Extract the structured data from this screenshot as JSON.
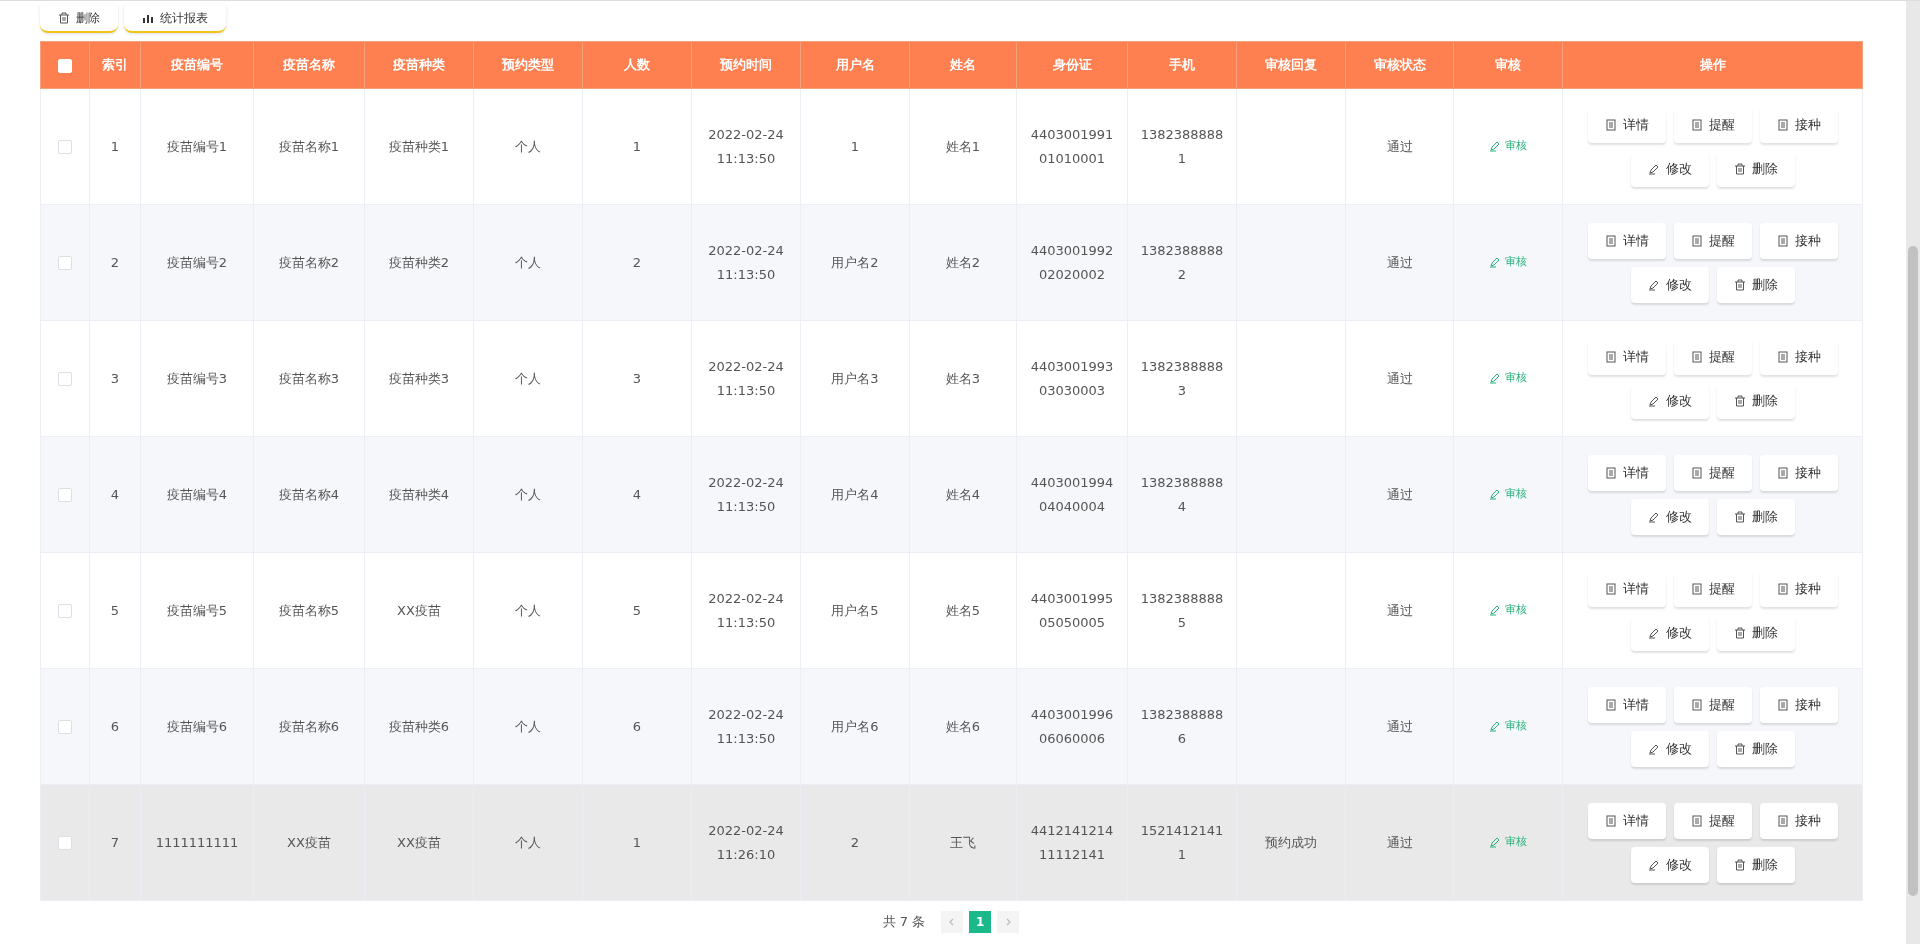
{
  "toolbar": [
    {
      "label": "删除",
      "kind": "trash"
    },
    {
      "label": "统计报表",
      "kind": "chart"
    }
  ],
  "table": {
    "select_all_checked": false,
    "columns": [
      "索引",
      "疫苗编号",
      "疫苗名称",
      "疫苗种类",
      "预约类型",
      "人数",
      "预约时间",
      "用户名",
      "姓名",
      "身份证",
      "手机",
      "审核回复",
      "审核状态",
      "审核",
      "操作"
    ],
    "rows": [
      {
        "checked": false,
        "hovered": false,
        "cells": [
          "1",
          "疫苗编号1",
          "疫苗名称1",
          "疫苗种类1",
          "个人",
          "1",
          "2022-02-24 11:13:50",
          "1",
          "姓名1",
          "440300199101010001",
          "13823888881",
          "",
          "通过"
        ],
        "audit": "审核",
        "actions": [
          {
            "label": "详情",
            "kind": "doc"
          },
          {
            "label": "提醒",
            "kind": "doc"
          },
          {
            "label": "接种",
            "kind": "doc"
          },
          {
            "label": "修改",
            "kind": "edit"
          },
          {
            "label": "删除",
            "kind": "trash"
          }
        ]
      },
      {
        "checked": false,
        "hovered": false,
        "cells": [
          "2",
          "疫苗编号2",
          "疫苗名称2",
          "疫苗种类2",
          "个人",
          "2",
          "2022-02-24 11:13:50",
          "用户名2",
          "姓名2",
          "440300199202020002",
          "13823888882",
          "",
          "通过"
        ],
        "audit": "审核",
        "actions": [
          {
            "label": "详情",
            "kind": "doc"
          },
          {
            "label": "提醒",
            "kind": "doc"
          },
          {
            "label": "接种",
            "kind": "doc"
          },
          {
            "label": "修改",
            "kind": "edit"
          },
          {
            "label": "删除",
            "kind": "trash"
          }
        ]
      },
      {
        "checked": false,
        "hovered": false,
        "cells": [
          "3",
          "疫苗编号3",
          "疫苗名称3",
          "疫苗种类3",
          "个人",
          "3",
          "2022-02-24 11:13:50",
          "用户名3",
          "姓名3",
          "440300199303030003",
          "13823888883",
          "",
          "通过"
        ],
        "audit": "审核",
        "actions": [
          {
            "label": "详情",
            "kind": "doc"
          },
          {
            "label": "提醒",
            "kind": "doc"
          },
          {
            "label": "接种",
            "kind": "doc"
          },
          {
            "label": "修改",
            "kind": "edit"
          },
          {
            "label": "删除",
            "kind": "trash"
          }
        ]
      },
      {
        "checked": false,
        "hovered": false,
        "cells": [
          "4",
          "疫苗编号4",
          "疫苗名称4",
          "疫苗种类4",
          "个人",
          "4",
          "2022-02-24 11:13:50",
          "用户名4",
          "姓名4",
          "440300199404040004",
          "13823888884",
          "",
          "通过"
        ],
        "audit": "审核",
        "actions": [
          {
            "label": "详情",
            "kind": "doc"
          },
          {
            "label": "提醒",
            "kind": "doc"
          },
          {
            "label": "接种",
            "kind": "doc"
          },
          {
            "label": "修改",
            "kind": "edit"
          },
          {
            "label": "删除",
            "kind": "trash"
          }
        ]
      },
      {
        "checked": false,
        "hovered": false,
        "cells": [
          "5",
          "疫苗编号5",
          "疫苗名称5",
          "XX疫苗",
          "个人",
          "5",
          "2022-02-24 11:13:50",
          "用户名5",
          "姓名5",
          "440300199505050005",
          "13823888885",
          "",
          "通过"
        ],
        "audit": "审核",
        "actions": [
          {
            "label": "详情",
            "kind": "doc"
          },
          {
            "label": "提醒",
            "kind": "doc"
          },
          {
            "label": "接种",
            "kind": "doc"
          },
          {
            "label": "修改",
            "kind": "edit"
          },
          {
            "label": "删除",
            "kind": "trash"
          }
        ]
      },
      {
        "checked": false,
        "hovered": false,
        "cells": [
          "6",
          "疫苗编号6",
          "疫苗名称6",
          "疫苗种类6",
          "个人",
          "6",
          "2022-02-24 11:13:50",
          "用户名6",
          "姓名6",
          "440300199606060006",
          "13823888886",
          "",
          "通过"
        ],
        "audit": "审核",
        "actions": [
          {
            "label": "详情",
            "kind": "doc"
          },
          {
            "label": "提醒",
            "kind": "doc"
          },
          {
            "label": "接种",
            "kind": "doc"
          },
          {
            "label": "修改",
            "kind": "edit"
          },
          {
            "label": "删除",
            "kind": "trash"
          }
        ]
      },
      {
        "checked": false,
        "hovered": true,
        "cells": [
          "7",
          "1111111111",
          "XX疫苗",
          "XX疫苗",
          "个人",
          "1",
          "2022-02-24 11:26:10",
          "2",
          "王飞",
          "441214121411112141",
          "15214121411",
          "预约成功",
          "通过"
        ],
        "audit": "审核",
        "actions": [
          {
            "label": "详情",
            "kind": "doc"
          },
          {
            "label": "提醒",
            "kind": "doc"
          },
          {
            "label": "接种",
            "kind": "doc"
          },
          {
            "label": "修改",
            "kind": "edit"
          },
          {
            "label": "删除",
            "kind": "trash"
          }
        ]
      }
    ]
  },
  "pagination": {
    "total": "共 7 条",
    "pages": [
      {
        "label": "1",
        "selected": true
      }
    ]
  }
}
